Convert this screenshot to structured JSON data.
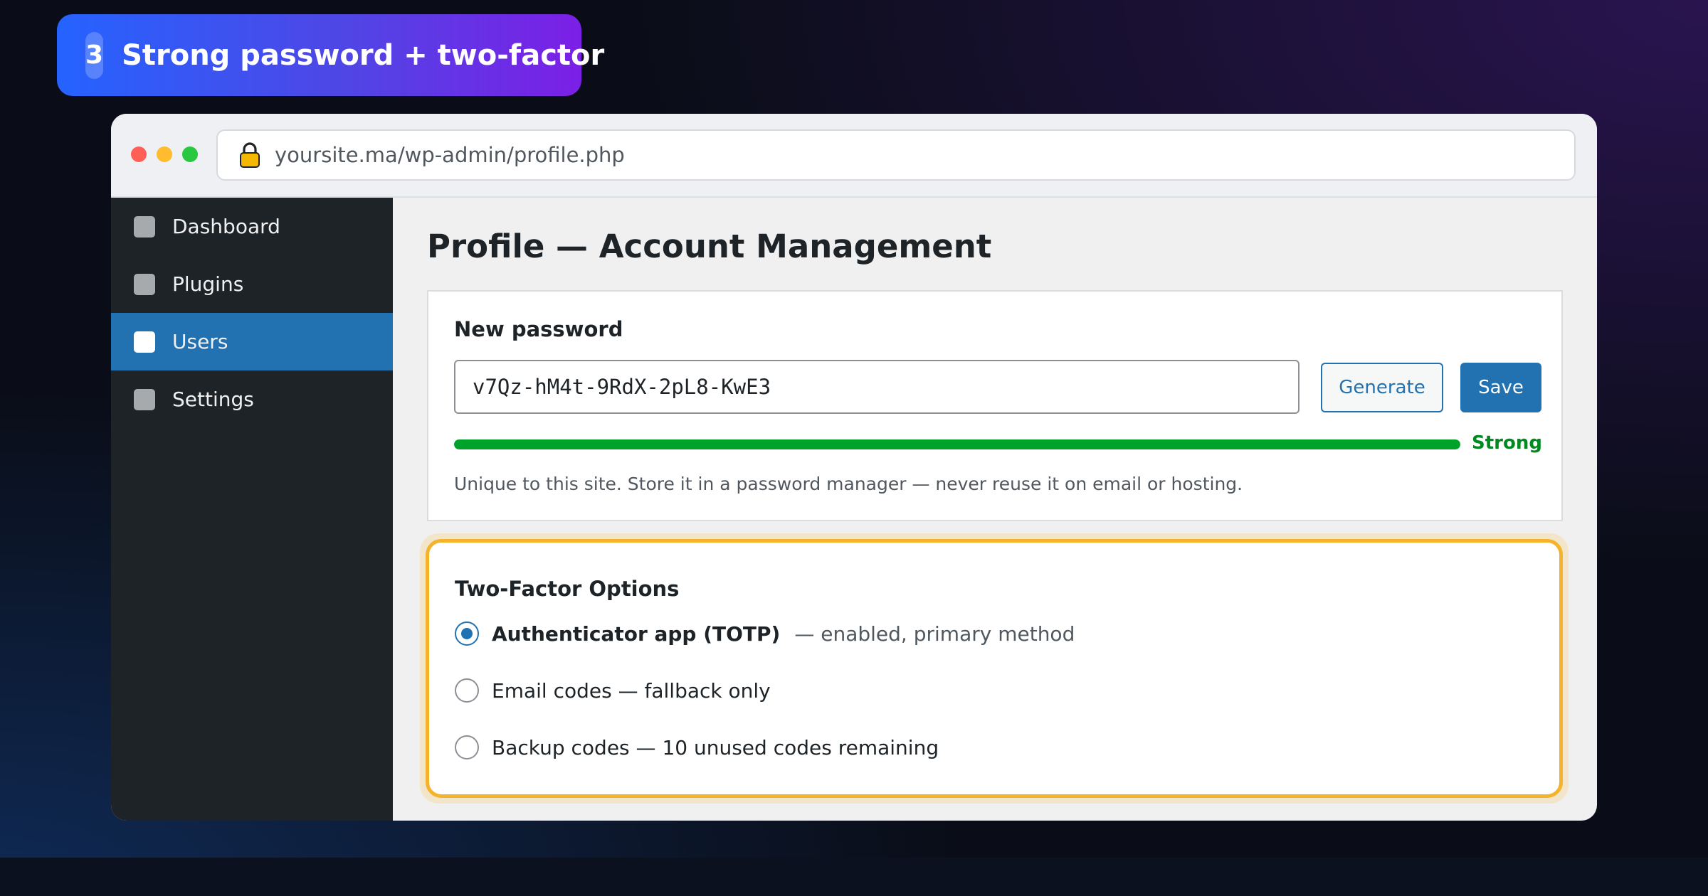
{
  "step": {
    "number": "3",
    "title": "Strong password + two-factor"
  },
  "browser": {
    "url": "yoursite.ma/wp-admin/profile.php"
  },
  "sidebar": {
    "items": [
      {
        "label": "Dashboard",
        "active": false
      },
      {
        "label": "Plugins",
        "active": false
      },
      {
        "label": "Users",
        "active": true
      },
      {
        "label": "Settings",
        "active": false
      }
    ]
  },
  "page": {
    "title": "Profile — Account Management"
  },
  "password": {
    "heading": "New password",
    "value": "v7Qz-hM4t-9RdX-2pL8-KwE3",
    "generate_label": "Generate",
    "save_label": "Save",
    "strength_label": "Strong",
    "strength_fraction": 1.0,
    "helper": "Unique to this site. Store it in a password manager — never reuse it on email or hosting."
  },
  "two_factor": {
    "heading": "Two-Factor Options",
    "options": [
      {
        "label": "Authenticator app (TOTP)",
        "note": "— enabled, primary method",
        "checked": true
      },
      {
        "label": "Email codes — fallback only",
        "note": "",
        "checked": false
      },
      {
        "label": "Backup codes — 10 unused codes remaining",
        "note": "",
        "checked": false
      }
    ]
  },
  "colors": {
    "accent": "#2271b1",
    "strength": "#00a32a",
    "highlight": "#f5b32b",
    "sidebar_bg": "#1d2327"
  }
}
